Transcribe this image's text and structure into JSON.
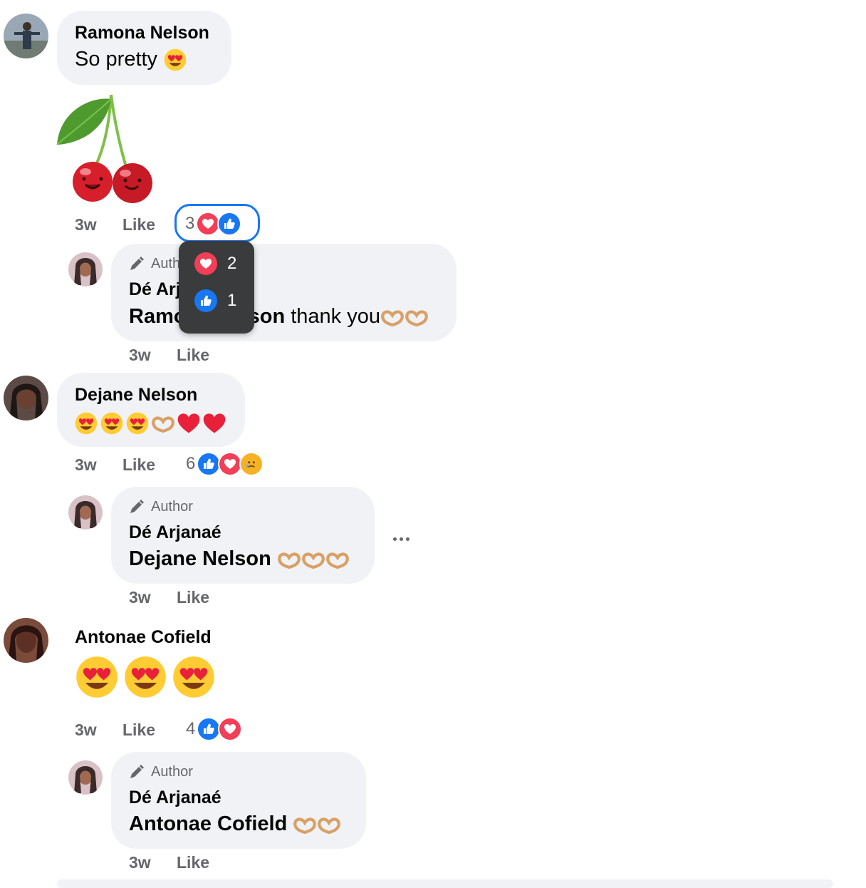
{
  "comments": [
    {
      "author": "Ramona Nelson",
      "text": "So pretty",
      "time": "3w",
      "like_label": "Like",
      "reaction_count": "3",
      "reactions": [
        "love",
        "like"
      ],
      "sticker": "cherry-sticker",
      "tooltip": {
        "love_count": "2",
        "like_count": "1"
      },
      "reply": {
        "badge": "Author",
        "author": "Dé Arjanaé",
        "mention": "Ramona Nelson",
        "text": "thank you",
        "time": "3w",
        "like_label": "Like"
      }
    },
    {
      "author": "Dejane Nelson",
      "time": "3w",
      "like_label": "Like",
      "reaction_count": "6",
      "reactions": [
        "like",
        "love",
        "sad"
      ],
      "reply": {
        "badge": "Author",
        "author": "Dé Arjanaé",
        "mention": "Dejane Nelson",
        "text": "",
        "time": "3w",
        "like_label": "Like"
      }
    },
    {
      "author": "Antonae Cofield",
      "time": "3w",
      "like_label": "Like",
      "reaction_count": "4",
      "reactions": [
        "like",
        "love"
      ],
      "reply": {
        "badge": "Author",
        "author": "Dé Arjanaé",
        "mention": "Antonae Cofield",
        "text": "",
        "time": "3w",
        "like_label": "Like"
      }
    }
  ],
  "colors": {
    "bubble": "#f0f2f5",
    "like": "#1877f2",
    "love": "#f33e58",
    "meta": "#65676b"
  }
}
